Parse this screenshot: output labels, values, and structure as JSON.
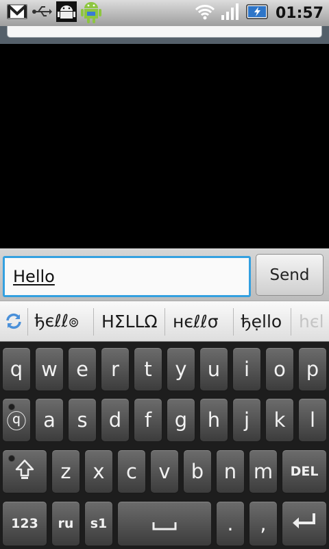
{
  "status_bar": {
    "time": "01:57",
    "left_icons": [
      "gmail-icon",
      "usb-icon",
      "android-debug-icon",
      "android-app-icon"
    ],
    "right_icons": [
      "wifi-icon",
      "signal-icon",
      "battery-charging-icon"
    ]
  },
  "compose": {
    "input_value": "Hello",
    "send_label": "Send"
  },
  "suggestions": {
    "cycle_icon": "cycle-icon",
    "items": [
      "ђєℓℓ๏",
      "ΗΣLLΩ",
      "нєℓℓσ",
      "ђẹllo",
      "hєl"
    ]
  },
  "keyboard": {
    "row1": [
      "q",
      "w",
      "e",
      "r",
      "t",
      "y",
      "u",
      "i",
      "o",
      "p"
    ],
    "row2": [
      "ⓠ",
      "a",
      "s",
      "d",
      "f",
      "g",
      "h",
      "j",
      "k",
      "l"
    ],
    "row3": [
      "z",
      "x",
      "c",
      "v",
      "b",
      "n",
      "m",
      "DEL"
    ],
    "row4": {
      "numbers": "123",
      "lang": "ru",
      "symbols": "s1",
      "period": ".",
      "comma": ","
    }
  }
}
